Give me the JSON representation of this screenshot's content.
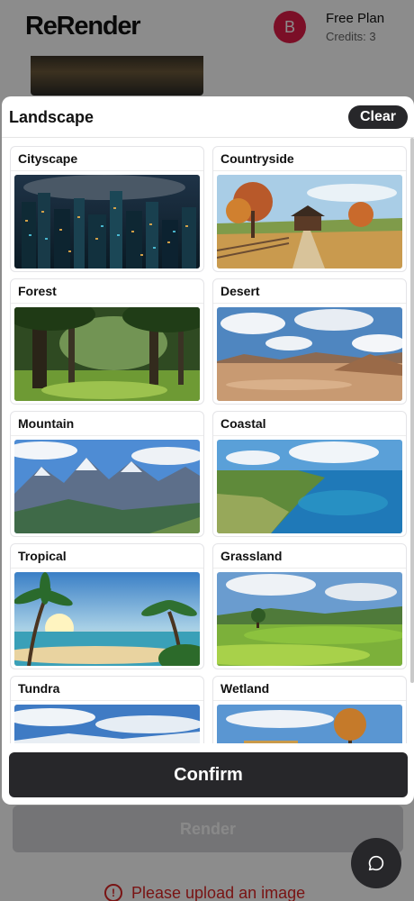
{
  "app": {
    "logo": "ReRender",
    "avatar_initial": "B",
    "plan_label": "Free Plan",
    "credits_label": "Credits: 3",
    "render_label": "Render",
    "error_message": "Please upload an image",
    "error_icon": "!"
  },
  "modal": {
    "title": "Landscape",
    "clear_label": "Clear",
    "confirm_label": "Confirm",
    "options": [
      {
        "label": "Cityscape",
        "icon": "cityscape-thumbnail"
      },
      {
        "label": "Countryside",
        "icon": "countryside-thumbnail"
      },
      {
        "label": "Forest",
        "icon": "forest-thumbnail"
      },
      {
        "label": "Desert",
        "icon": "desert-thumbnail"
      },
      {
        "label": "Mountain",
        "icon": "mountain-thumbnail"
      },
      {
        "label": "Coastal",
        "icon": "coastal-thumbnail"
      },
      {
        "label": "Tropical",
        "icon": "tropical-thumbnail"
      },
      {
        "label": "Grassland",
        "icon": "grassland-thumbnail"
      },
      {
        "label": "Tundra",
        "icon": "tundra-thumbnail"
      },
      {
        "label": "Wetland",
        "icon": "wetland-thumbnail"
      }
    ]
  },
  "colors": {
    "accent_dark": "#27272a",
    "avatar": "#e11d48",
    "error": "#dc2626"
  }
}
